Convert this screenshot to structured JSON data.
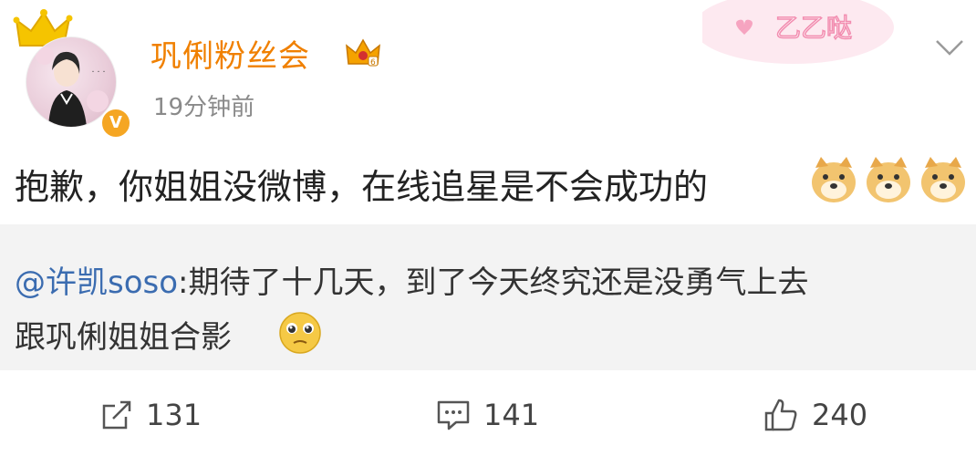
{
  "post": {
    "author": "巩俐粉丝会",
    "time": "19分钟前",
    "text": "抱歉，你姐姐没微博，在线追星是不会成功的",
    "sticker_text": "乙乙哒"
  },
  "quote": {
    "mention": "@许凯soso",
    "line1_rest": ":期待了十几天，到了今天终究还是没勇气上去",
    "line2": "跟巩俐姐姐合影"
  },
  "actions": {
    "repost_count": "131",
    "comment_count": "141",
    "like_count": "240"
  },
  "colors": {
    "username": "#f08000",
    "mention": "#3b6cb0",
    "quote_bg": "#f3f3f3"
  }
}
